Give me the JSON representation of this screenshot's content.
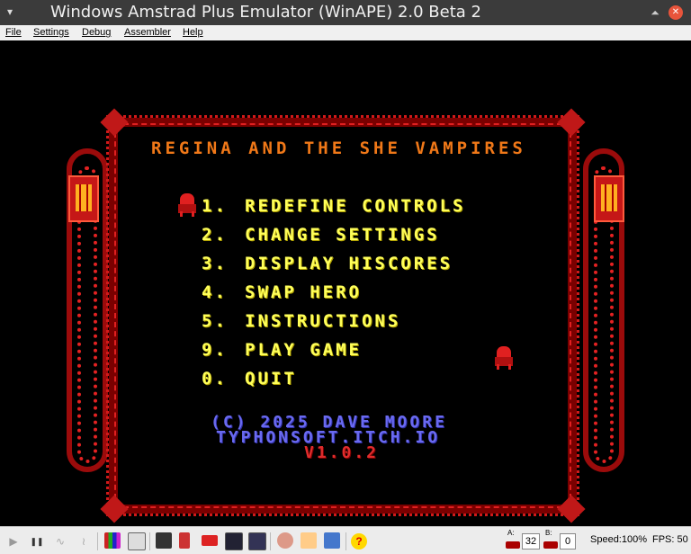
{
  "window": {
    "title": "Windows Amstrad Plus Emulator (WinAPE) 2.0 Beta 2",
    "menu_glyph": "▾",
    "minimize_glyph": "⏶",
    "close_glyph": "✕"
  },
  "menu": [
    "File",
    "Settings",
    "Debug",
    "Assembler",
    "Help"
  ],
  "game": {
    "title": "REGINA AND THE SHE VAMPIRES",
    "options": [
      {
        "num": "1.",
        "label": "REDEFINE CONTROLS"
      },
      {
        "num": "2.",
        "label": "CHANGE SETTINGS"
      },
      {
        "num": "3.",
        "label": "DISPLAY HISCORES"
      },
      {
        "num": "4.",
        "label": "SWAP HERO"
      },
      {
        "num": "5.",
        "label": "INSTRUCTIONS"
      },
      {
        "num": "9.",
        "label": "PLAY GAME"
      },
      {
        "num": "0.",
        "label": "QUIT"
      }
    ],
    "credit": "(C) 2025 DAVE MOORE",
    "website": "TYPHONSOFT.ITCH.IO",
    "version": "V1.0.2",
    "colors": {
      "title": "#f07818",
      "menu": "#ffff5a",
      "credit": "#6a6af0",
      "version": "#e02c2c",
      "frame": "#c01818"
    }
  },
  "status": {
    "play_glyph": "▶",
    "pause_glyph": "❚❚",
    "drive_a_label": "A:",
    "drive_a_value": "32",
    "drive_b_label": "B:",
    "drive_b_value": "0",
    "speed": "Speed:100%",
    "fps": "FPS: 50",
    "help_glyph": "?"
  }
}
